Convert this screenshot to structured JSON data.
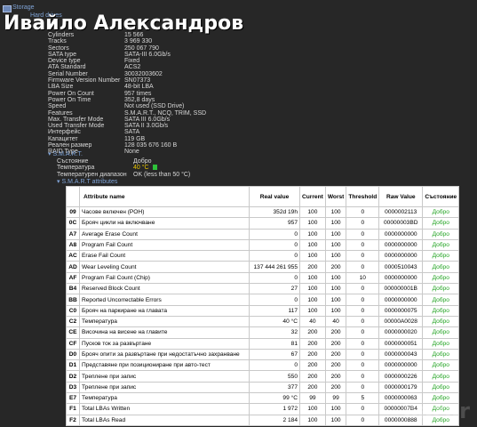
{
  "tree": {
    "storage_label": "Storage",
    "hard_drives_label": "Hard drives"
  },
  "overlay_name": "Ивайло Александров",
  "properties": [
    {
      "key": "Cylinders",
      "value": "15 566"
    },
    {
      "key": "Tracks",
      "value": "3 969 330"
    },
    {
      "key": "Sectors",
      "value": "250 067 790"
    },
    {
      "key": "SATA type",
      "value": "SATA-III 6.0Gb/s"
    },
    {
      "key": "Device type",
      "value": "Fixed"
    },
    {
      "key": "ATA Standard",
      "value": "ACS2"
    },
    {
      "key": "Serial Number",
      "value": "30032003602"
    },
    {
      "key": "Firmware Version Number",
      "value": "SN07373"
    },
    {
      "key": "LBA Size",
      "value": "48-bit LBA"
    },
    {
      "key": "Power On Count",
      "value": "957 times"
    },
    {
      "key": "Power On Time",
      "value": "352,8 days"
    },
    {
      "key": "Speed",
      "value": "Not used (SSD Drive)"
    },
    {
      "key": "Features",
      "value": "S.M.A.R.T., NCQ, TRIM, SSD"
    },
    {
      "key": "Max. Transfer Mode",
      "value": "SATA III 6.0Gb/s"
    },
    {
      "key": "Used Transfer Mode",
      "value": "SATA II 3.0Gb/s"
    },
    {
      "key": "Интерфейс",
      "value": "SATA"
    },
    {
      "key": "Капацитет",
      "value": "119 GB"
    },
    {
      "key": "Реален размер",
      "value": "128 035 676 160 B"
    },
    {
      "key": "RAID Type",
      "value": "None"
    }
  ],
  "smart": {
    "header": "S.M.A.R.T.",
    "status_key": "Състояние",
    "status_value": "Добро",
    "temp_key": "Температура",
    "temp_value": "40 °C",
    "range_key": "Температурен диапазон",
    "range_value": "OK (less than 50 °C)",
    "attributes_header": "S.M.A.R.T attributes"
  },
  "table": {
    "headers": {
      "name": "Attribute name",
      "real": "Real value",
      "current": "Current",
      "worst": "Worst",
      "threshold": "Threshold",
      "raw": "Raw Value",
      "status": "Състояние"
    },
    "rows": [
      {
        "id": "09",
        "name": "Часове включен (POH)",
        "real": "352d 19h",
        "cur": "100",
        "worst": "100",
        "thr": "0",
        "raw": "0000002113",
        "st": "Добро"
      },
      {
        "id": "0C",
        "name": "Брояч цикли на включване",
        "real": "957",
        "cur": "100",
        "worst": "100",
        "thr": "0",
        "raw": "00000003BD",
        "st": "Добро"
      },
      {
        "id": "A7",
        "name": "Average Erase Count",
        "real": "0",
        "cur": "100",
        "worst": "100",
        "thr": "0",
        "raw": "0000000000",
        "st": "Добро"
      },
      {
        "id": "A8",
        "name": "Program Fail Count",
        "real": "0",
        "cur": "100",
        "worst": "100",
        "thr": "0",
        "raw": "0000000000",
        "st": "Добро"
      },
      {
        "id": "AC",
        "name": "Erase Fail Count",
        "real": "0",
        "cur": "100",
        "worst": "100",
        "thr": "0",
        "raw": "0000000000",
        "st": "Добро"
      },
      {
        "id": "AD",
        "name": "Wear Leveling Count",
        "real": "137 444 261 955",
        "cur": "200",
        "worst": "200",
        "thr": "0",
        "raw": "0000510043",
        "st": "Добро"
      },
      {
        "id": "AF",
        "name": "Program Fail Count (Chip)",
        "real": "0",
        "cur": "100",
        "worst": "100",
        "thr": "10",
        "raw": "0000000000",
        "st": "Добро"
      },
      {
        "id": "B4",
        "name": "Reserved Block Count",
        "real": "27",
        "cur": "100",
        "worst": "100",
        "thr": "0",
        "raw": "000000001B",
        "st": "Добро"
      },
      {
        "id": "BB",
        "name": "Reported Uncorrectable Errors",
        "real": "0",
        "cur": "100",
        "worst": "100",
        "thr": "0",
        "raw": "0000000000",
        "st": "Добро"
      },
      {
        "id": "C0",
        "name": "Брояч на паркиране на главата",
        "real": "117",
        "cur": "100",
        "worst": "100",
        "thr": "0",
        "raw": "0000000075",
        "st": "Добро"
      },
      {
        "id": "C2",
        "name": "Температура",
        "real": "40 °C",
        "cur": "40",
        "worst": "40",
        "thr": "0",
        "raw": "00000A0028",
        "st": "Добро"
      },
      {
        "id": "CE",
        "name": "Височина на висене на главите",
        "real": "32",
        "cur": "200",
        "worst": "200",
        "thr": "0",
        "raw": "0000000020",
        "st": "Добро"
      },
      {
        "id": "CF",
        "name": "Пусков ток за развъртане",
        "real": "81",
        "cur": "200",
        "worst": "200",
        "thr": "0",
        "raw": "0000000051",
        "st": "Добро"
      },
      {
        "id": "D0",
        "name": "Брояч опити за развъртане при недостатъчно захранване",
        "real": "67",
        "cur": "200",
        "worst": "200",
        "thr": "0",
        "raw": "0000000043",
        "st": "Добро"
      },
      {
        "id": "D1",
        "name": "Представяне при позициониране при авто-тест",
        "real": "0",
        "cur": "200",
        "worst": "200",
        "thr": "0",
        "raw": "0000000000",
        "st": "Добро"
      },
      {
        "id": "D2",
        "name": "Треплене при запис",
        "real": "550",
        "cur": "200",
        "worst": "200",
        "thr": "0",
        "raw": "0000000226",
        "st": "Добро"
      },
      {
        "id": "D3",
        "name": "Треплене при запис",
        "real": "377",
        "cur": "200",
        "worst": "200",
        "thr": "0",
        "raw": "0000000179",
        "st": "Добро"
      },
      {
        "id": "E7",
        "name": "Температура",
        "real": "99 °C",
        "cur": "99",
        "worst": "99",
        "thr": "5",
        "raw": "0000000063",
        "st": "Добро"
      },
      {
        "id": "F1",
        "name": "Total LBAs Written",
        "real": "1 972",
        "cur": "100",
        "worst": "100",
        "thr": "0",
        "raw": "00000007B4",
        "st": "Добро"
      },
      {
        "id": "F2",
        "name": "Total LBAs Read",
        "real": "2 184",
        "cur": "100",
        "worst": "100",
        "thr": "0",
        "raw": "0000000888",
        "st": "Добро"
      }
    ]
  }
}
